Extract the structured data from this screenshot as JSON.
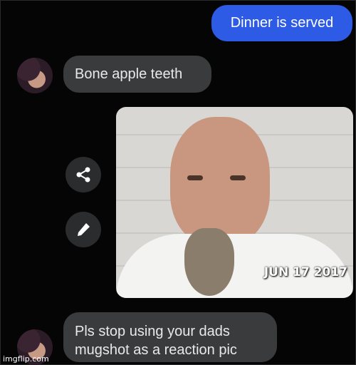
{
  "messages": {
    "outgoing_1": "Dinner is served",
    "incoming_1": "Bone apple teeth",
    "incoming_2_line1": "Pls stop using your dads",
    "incoming_2_line2": "mugshot as a reaction pic"
  },
  "photo": {
    "date_stamp": "JUN 17 2017"
  },
  "actions": {
    "share_icon": "share-icon",
    "edit_icon": "pencil-icon"
  },
  "watermark": "imgflip.com",
  "colors": {
    "background": "#050505",
    "outgoing_bubble": "#2e5be6",
    "incoming_bubble": "#3a3b3d",
    "action_button": "#2b2c2e"
  }
}
